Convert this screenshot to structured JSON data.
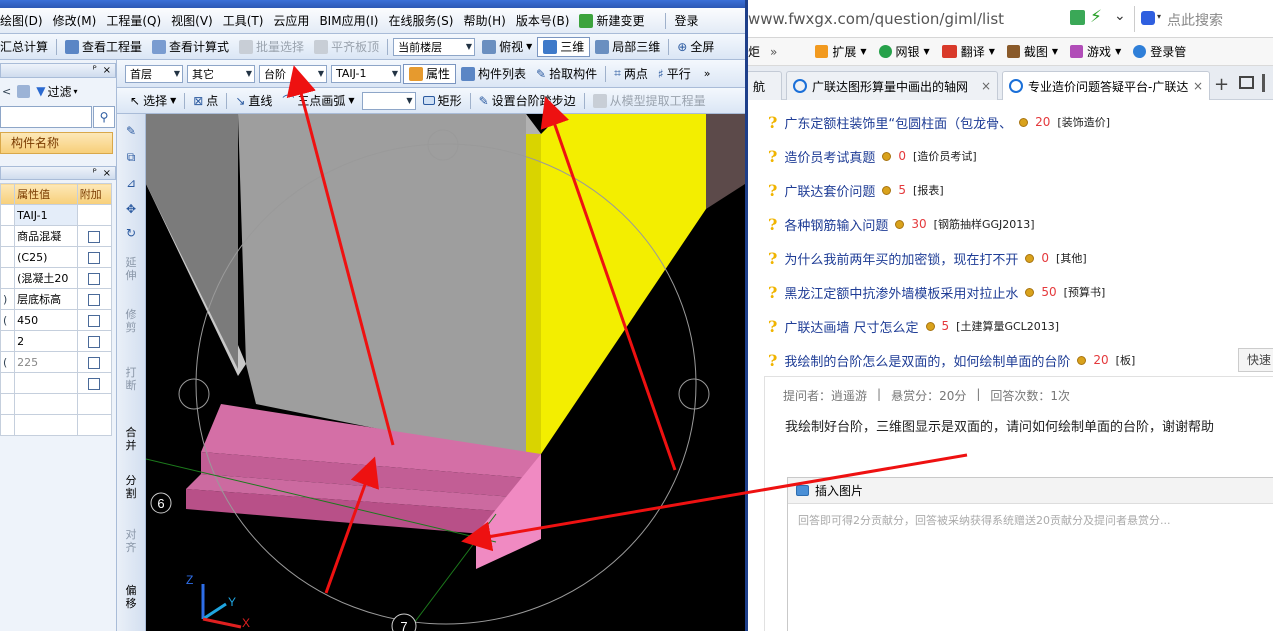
{
  "menubar": {
    "items": [
      "绘图(D)",
      "修改(M)",
      "工程量(Q)",
      "视图(V)",
      "工具(T)",
      "云应用",
      "BIM应用(I)",
      "在线服务(S)",
      "帮助(H)",
      "版本号(B)"
    ],
    "new_change": "新建变更",
    "login": "登录"
  },
  "toolbar1": {
    "calc": "汇总计算",
    "view_project": "查看工程量",
    "view_formula": "查看计算式",
    "batch_select": "批量选择",
    "flat_slab_top": "平齐板顶",
    "floor_combo": "当前楼层",
    "view_mode": "俯视",
    "three_d": "三维",
    "local_3d": "局部三维",
    "fullscreen": "全屏"
  },
  "toolbar2": {
    "floor": "首层",
    "category": "其它",
    "element_type": "台阶",
    "element_name": "TAIJ-1",
    "attribute": "属性",
    "component_list": "构件列表",
    "pick_component": "拾取构件",
    "two_points": "两点",
    "parallel": "平行"
  },
  "toolbar3": {
    "select": "选择",
    "point": "点",
    "line": "直线",
    "arc": "三点画弧",
    "rect": "矩形",
    "set_step_edge": "设置台阶踏步边",
    "extract_from_model": "从模型提取工程量"
  },
  "left_panel": {
    "filter": "过滤",
    "component_name_header": "构件名称",
    "pin_symbol": "ᴾ",
    "close_symbol": "×"
  },
  "props": {
    "header_value": "属性值",
    "header_extra": "附加",
    "rows": [
      {
        "value": "TAIJ-1",
        "check": false
      },
      {
        "value": "商品混凝",
        "check": true
      },
      {
        "value": "(C25)",
        "check": true
      },
      {
        "value": "(混凝土20",
        "check": true
      },
      {
        "value": "层底标高",
        "check": true
      },
      {
        "value": "450",
        "check": true
      },
      {
        "value": "2",
        "check": true
      },
      {
        "value": "225",
        "check": true
      },
      {
        "value": "",
        "check": true
      },
      {
        "value": "",
        "check": false
      },
      {
        "value": "",
        "check": false
      }
    ]
  },
  "vtools": {
    "extend": "延伸",
    "trim": "修剪",
    "break": "打断",
    "merge": "合并",
    "split": "分割",
    "align": "对齐",
    "offset": "偏移"
  },
  "viewport": {
    "axis6": "6",
    "axis7": "7",
    "z_label": "Z",
    "y_label": "Y",
    "x_label": "X"
  },
  "browser": {
    "url": "www.fwxgx.com/question/giml/list",
    "search_placeholder": "点此搜索",
    "fav_items": [
      "扩展",
      "网银",
      "翻译",
      "截图",
      "游戏",
      "登录管"
    ],
    "fav_left": "炬",
    "tabs": [
      {
        "label": "航"
      },
      {
        "label": "广联达图形算量中画出的轴网"
      },
      {
        "label": "专业造价问题答疑平台-广联达"
      }
    ],
    "questions": [
      {
        "title": "广东定额柱装饰里“包圆柱面（包龙骨、",
        "score": "20",
        "category": "[装饰造价]"
      },
      {
        "title": "造价员考试真题",
        "score": "0",
        "category": "[造价员考试]"
      },
      {
        "title": "广联达套价问题",
        "score": "5",
        "category": "[报表]"
      },
      {
        "title": "各种钢筋输入问题",
        "score": "30",
        "category": "[钢筋抽样GGJ2013]"
      },
      {
        "title": "为什么我前两年买的加密锁，现在打不开",
        "score": "0",
        "category": "[其他]"
      },
      {
        "title": "黑龙江定额中抗渗外墙模板采用对拉止水",
        "score": "50",
        "category": "[预算书]"
      },
      {
        "title": "广联达画墙 尺寸怎么定",
        "score": "5",
        "category": "[土建算量GCL2013]"
      },
      {
        "title": "我绘制的台阶怎么是双面的，如何绘制单面的台阶",
        "score": "20",
        "category": "[板]"
      }
    ],
    "quick_btn": "快速",
    "detail": {
      "asker": "提问者：逍遥游",
      "reward": "悬赏分：20分",
      "answers": "回答次数：1次",
      "body": "我绘制好台阶，三维图显示是双面的，请问如何绘制单面的台阶，谢谢帮助",
      "insert_image": "插入图片",
      "answer_placeholder": "回答即可得2分贡献分，回答被采纳获得系统赠送20贡献分及提问者悬赏分..."
    }
  }
}
